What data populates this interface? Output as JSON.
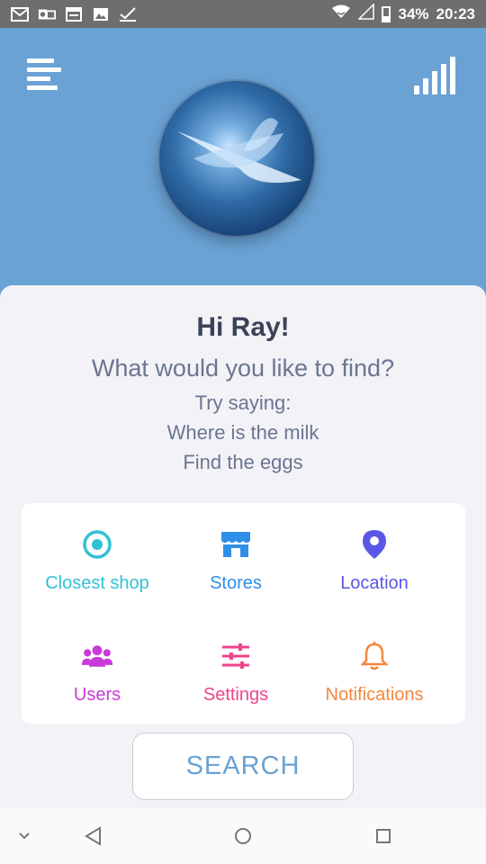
{
  "status_bar": {
    "battery": "34%",
    "time": "20:23",
    "icons": [
      "gmail-icon",
      "outlook-icon",
      "calendar-icon",
      "gallery-icon",
      "check-icon",
      "wifi-icon",
      "cell-signal-icon",
      "battery-icon"
    ]
  },
  "header": {
    "menu_icon": "menu-icon",
    "signal_icon": "signal-strength-icon",
    "orb_icon": "voice-assistant-orb"
  },
  "card": {
    "greeting": "Hi Ray!",
    "question": "What would you like to find?",
    "hints": [
      "Try saying:",
      "Where is the milk",
      "Find the eggs"
    ]
  },
  "tiles": [
    {
      "label": "Closest shop",
      "icon": "target-icon",
      "color": "#30c2d6"
    },
    {
      "label": "Stores",
      "icon": "store-icon",
      "color": "#2e8fe8"
    },
    {
      "label": "Location",
      "icon": "map-pin-icon",
      "color": "#5b57e6"
    },
    {
      "label": "Users",
      "icon": "users-icon",
      "color": "#c83ad9"
    },
    {
      "label": "Settings",
      "icon": "sliders-icon",
      "color": "#f0438a"
    },
    {
      "label": "Notifications",
      "icon": "bell-icon",
      "color": "#f7863e"
    }
  ],
  "search_button": {
    "label": "SEARCH"
  },
  "nav_bar": {
    "items": [
      "collapse-icon",
      "back-icon",
      "home-icon",
      "recents-icon"
    ]
  }
}
